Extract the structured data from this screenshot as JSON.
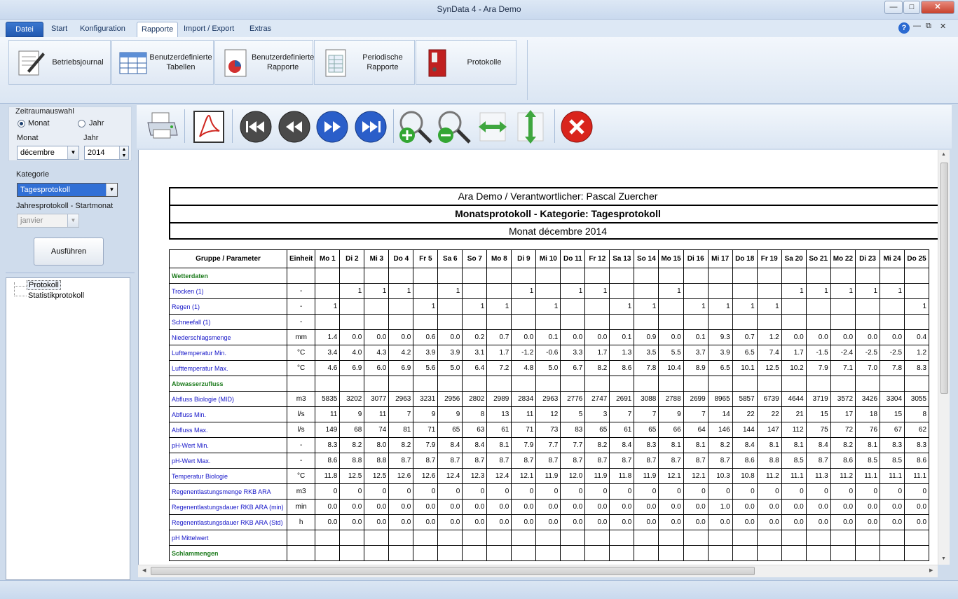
{
  "window": {
    "title": "SynData 4 - Ara Demo"
  },
  "tabs": [
    {
      "label": "Datei"
    },
    {
      "label": "Start"
    },
    {
      "label": "Konfiguration"
    },
    {
      "label": "Rapporte"
    },
    {
      "label": "Import / Export"
    },
    {
      "label": "Extras"
    }
  ],
  "ribbon": [
    {
      "label": "Betriebsjournal"
    },
    {
      "label": "Benutzerdefinierte Tabellen"
    },
    {
      "label": "Benutzerdefinierte Rapporte"
    },
    {
      "label": "Periodische Rapporte"
    },
    {
      "label": "Protokolle"
    }
  ],
  "left": {
    "period_title": "Zeitraumauswahl",
    "radio_month": "Monat",
    "radio_year": "Jahr",
    "month_label": "Monat",
    "year_label": "Jahr",
    "month_value": "décembre",
    "year_value": "2014",
    "category_label": "Kategorie",
    "category_value": "Tagesprotokoll",
    "start_month_label": "Jahresprotokoll - Startmonat",
    "start_month_value": "janvier",
    "run_button": "Ausführen",
    "tree": [
      "Protokoll",
      "Statistikprotokoll"
    ]
  },
  "toolbar": [
    "printer-icon",
    "pdf-icon",
    "first-page-icon",
    "previous-page-icon",
    "next-page-icon",
    "last-page-icon",
    "zoom-in-icon",
    "zoom-out-icon",
    "fit-width-icon",
    "fit-height-icon",
    "close-icon"
  ],
  "report": {
    "header1": "Ara Demo / Verantwortlicher: Pascal Zuercher",
    "header2": "Monatsprotokoll - Kategorie: Tagesprotokoll",
    "header3": "Monat décembre 2014",
    "col_param": "Gruppe / Parameter",
    "col_unit": "Einheit",
    "days": [
      "Mo 1",
      "Di 2",
      "Mi 3",
      "Do 4",
      "Fr 5",
      "Sa 6",
      "So 7",
      "Mo 8",
      "Di 9",
      "Mi 10",
      "Do 11",
      "Fr 12",
      "Sa 13",
      "So 14",
      "Mo 15",
      "Di 16",
      "Mi 17",
      "Do 18",
      "Fr 19",
      "Sa 20",
      "So 21",
      "Mo 22",
      "Di 23",
      "Mi 24",
      "Do 25"
    ],
    "rows": [
      {
        "group": "Wetterdaten"
      },
      {
        "name": "Trocken (1)",
        "unit": "-",
        "values": [
          "",
          "1",
          "1",
          "1",
          "",
          "1",
          "",
          "",
          "1",
          "",
          "1",
          "1",
          "",
          "",
          "1",
          "",
          "",
          "",
          "",
          "1",
          "1",
          "1",
          "1",
          "1",
          ""
        ]
      },
      {
        "name": "Regen (1)",
        "unit": "-",
        "values": [
          "1",
          "",
          "",
          "",
          "1",
          "",
          "1",
          "1",
          "",
          "1",
          "",
          "",
          "1",
          "1",
          "",
          "1",
          "1",
          "1",
          "1",
          "",
          "",
          "",
          "",
          "",
          "1"
        ]
      },
      {
        "name": "Schneefall (1)",
        "unit": "-",
        "values": [
          "",
          "",
          "",
          "",
          "",
          "",
          "",
          "",
          "",
          "",
          "",
          "",
          "",
          "",
          "",
          "",
          "",
          "",
          "",
          "",
          "",
          "",
          "",
          "",
          ""
        ]
      },
      {
        "name": "Niederschlagsmenge",
        "unit": "mm",
        "values": [
          "1.4",
          "0.0",
          "0.0",
          "0.0",
          "0.6",
          "0.0",
          "0.2",
          "0.7",
          "0.0",
          "0.1",
          "0.0",
          "0.0",
          "0.1",
          "0.9",
          "0.0",
          "0.1",
          "9.3",
          "0.7",
          "1.2",
          "0.0",
          "0.0",
          "0.0",
          "0.0",
          "0.0",
          "0.4"
        ]
      },
      {
        "name": "Lufttemperatur Min.",
        "unit": "°C",
        "values": [
          "3.4",
          "4.0",
          "4.3",
          "4.2",
          "3.9",
          "3.9",
          "3.1",
          "1.7",
          "-1.2",
          "-0.6",
          "3.3",
          "1.7",
          "1.3",
          "3.5",
          "5.5",
          "3.7",
          "3.9",
          "6.5",
          "7.4",
          "1.7",
          "-1.5",
          "-2.4",
          "-2.5",
          "-2.5",
          "1.2"
        ]
      },
      {
        "name": "Lufttemperatur Max.",
        "unit": "°C",
        "values": [
          "4.6",
          "6.9",
          "6.0",
          "6.9",
          "5.6",
          "5.0",
          "6.4",
          "7.2",
          "4.8",
          "5.0",
          "6.7",
          "8.2",
          "8.6",
          "7.8",
          "10.4",
          "8.9",
          "6.5",
          "10.1",
          "12.5",
          "10.2",
          "7.9",
          "7.1",
          "7.0",
          "7.8",
          "8.3"
        ]
      },
      {
        "group": "Abwasserzufluss"
      },
      {
        "name": "Abfluss Biologie (MID)",
        "unit": "m3",
        "values": [
          "5835",
          "3202",
          "3077",
          "2963",
          "3231",
          "2956",
          "2802",
          "2989",
          "2834",
          "2963",
          "2776",
          "2747",
          "2691",
          "3088",
          "2788",
          "2699",
          "8965",
          "5857",
          "6739",
          "4644",
          "3719",
          "3572",
          "3426",
          "3304",
          "3055"
        ]
      },
      {
        "name": "Abfluss Min.",
        "unit": "l/s",
        "values": [
          "11",
          "9",
          "11",
          "7",
          "9",
          "9",
          "8",
          "13",
          "11",
          "12",
          "5",
          "3",
          "7",
          "7",
          "9",
          "7",
          "14",
          "22",
          "22",
          "21",
          "15",
          "17",
          "18",
          "15",
          "8"
        ]
      },
      {
        "name": "Abfluss Max.",
        "unit": "l/s",
        "values": [
          "149",
          "68",
          "74",
          "81",
          "71",
          "65",
          "63",
          "61",
          "71",
          "73",
          "83",
          "65",
          "61",
          "65",
          "66",
          "64",
          "146",
          "144",
          "147",
          "112",
          "75",
          "72",
          "76",
          "67",
          "62"
        ]
      },
      {
        "name": "pH-Wert Min.",
        "unit": "-",
        "values": [
          "8.3",
          "8.2",
          "8.0",
          "8.2",
          "7.9",
          "8.4",
          "8.4",
          "8.1",
          "7.9",
          "7.7",
          "7.7",
          "8.2",
          "8.4",
          "8.3",
          "8.1",
          "8.1",
          "8.2",
          "8.4",
          "8.1",
          "8.1",
          "8.4",
          "8.2",
          "8.1",
          "8.3",
          "8.3"
        ]
      },
      {
        "name": "pH-Wert Max.",
        "unit": "-",
        "values": [
          "8.6",
          "8.8",
          "8.8",
          "8.7",
          "8.7",
          "8.7",
          "8.7",
          "8.7",
          "8.7",
          "8.7",
          "8.7",
          "8.7",
          "8.7",
          "8.7",
          "8.7",
          "8.7",
          "8.7",
          "8.6",
          "8.8",
          "8.5",
          "8.7",
          "8.6",
          "8.5",
          "8.5",
          "8.6"
        ]
      },
      {
        "name": "Temperatur Biologie",
        "unit": "°C",
        "values": [
          "11.8",
          "12.5",
          "12.5",
          "12.6",
          "12.6",
          "12.4",
          "12.3",
          "12.4",
          "12.1",
          "11.9",
          "12.0",
          "11.9",
          "11.8",
          "11.9",
          "12.1",
          "12.1",
          "10.3",
          "10.8",
          "11.2",
          "11.1",
          "11.3",
          "11.2",
          "11.1",
          "11.1",
          "11.1"
        ]
      },
      {
        "name": "Regenentlastungsmenge RKB ARA",
        "unit": "m3",
        "values": [
          "0",
          "0",
          "0",
          "0",
          "0",
          "0",
          "0",
          "0",
          "0",
          "0",
          "0",
          "0",
          "0",
          "0",
          "0",
          "0",
          "0",
          "0",
          "0",
          "0",
          "0",
          "0",
          "0",
          "0",
          "0"
        ]
      },
      {
        "name": "Regenentlastungsdauer RKB ARA (min)",
        "unit": "min",
        "values": [
          "0.0",
          "0.0",
          "0.0",
          "0.0",
          "0.0",
          "0.0",
          "0.0",
          "0.0",
          "0.0",
          "0.0",
          "0.0",
          "0.0",
          "0.0",
          "0.0",
          "0.0",
          "0.0",
          "1.0",
          "0.0",
          "0.0",
          "0.0",
          "0.0",
          "0.0",
          "0.0",
          "0.0",
          "0.0"
        ]
      },
      {
        "name": "Regenentlastungsdauer RKB ARA (Std)",
        "unit": "h",
        "values": [
          "0.0",
          "0.0",
          "0.0",
          "0.0",
          "0.0",
          "0.0",
          "0.0",
          "0.0",
          "0.0",
          "0.0",
          "0.0",
          "0.0",
          "0.0",
          "0.0",
          "0.0",
          "0.0",
          "0.0",
          "0.0",
          "0.0",
          "0.0",
          "0.0",
          "0.0",
          "0.0",
          "0.0",
          "0.0"
        ]
      },
      {
        "name": "pH Mittelwert",
        "unit": "",
        "values": [
          "",
          "",
          "",
          "",
          "",
          "",
          "",
          "",
          "",
          "",
          "",
          "",
          "",
          "",
          "",
          "",
          "",
          "",
          "",
          "",
          "",
          "",
          "",
          "",
          ""
        ]
      },
      {
        "group": "Schlammengen"
      }
    ]
  },
  "colors": {
    "param": "#1515c8",
    "group": "#1b7a1b",
    "accent": "#2158b0"
  }
}
